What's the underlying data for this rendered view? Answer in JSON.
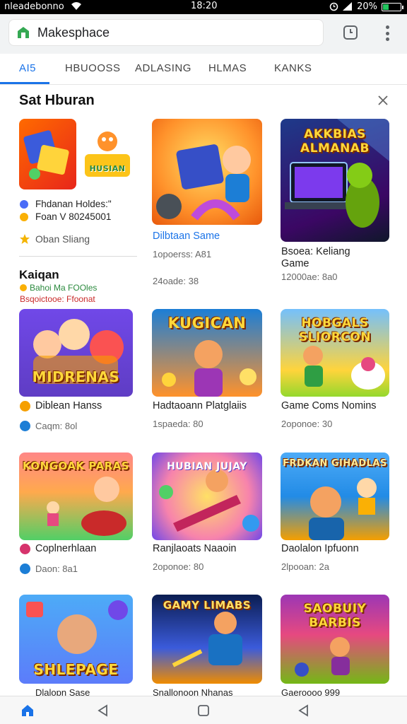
{
  "status_bar": {
    "carrier": "nleadebonno",
    "time": "18:20",
    "battery": "20%"
  },
  "browser": {
    "url": "Makesphace"
  },
  "tabs": [
    {
      "label": "AI5",
      "active": true
    },
    {
      "label": "HBUOOSS",
      "active": false
    },
    {
      "label": "ADLASING",
      "active": false
    },
    {
      "label": "HLMAS",
      "active": false
    },
    {
      "label": "KANKS",
      "active": false
    }
  ],
  "section": {
    "title": "Sat Hburan"
  },
  "promo": {
    "art_text": "HUSIAN",
    "line1": "Fhdanan Holdes:\"",
    "line2": "Foan V 80245001",
    "line3": "Oban Sliang"
  },
  "subsection": {
    "title": "Kaiqan",
    "line1": "Bahoi Ma FOOles",
    "line2": "Bsqoictooe: Ffoonat"
  },
  "games": [
    {
      "name": "Dilbtaan Same",
      "meta": "1opoerss: A81",
      "meta2": "24oade: 38",
      "art": ""
    },
    {
      "name": "Bsoea: Keliang Game",
      "meta": "12000ae: 8a0",
      "art": "AKKBIAS ALMANAB"
    },
    {
      "name": "Diblean Hanss",
      "meta": "Caqm: 8ol",
      "art": "MIDRENAS"
    },
    {
      "name": "Hadtaoann Platglaiis",
      "meta": "1spaeda: 80",
      "art": "KUGICAN"
    },
    {
      "name": "Game Coms Nomins",
      "meta": "2oponoe: 30",
      "art": "HOBGALS SLIORCON"
    },
    {
      "name": "Coplnerhlaan",
      "meta": "Daon: 8a1",
      "art": "KONGOAK PARAS"
    },
    {
      "name": "Ranjlaoats Naaoin",
      "meta": "2oponoe: 80",
      "art": "HUBIAN JUJAY"
    },
    {
      "name": "Daolalon Ipfuonn",
      "meta": "2lpooan: 2a",
      "art": "FRDKAN GIHADLAS"
    },
    {
      "name": "Dlalopn Sase",
      "meta": "",
      "art": "SHLEPAGE"
    },
    {
      "name": "Snallonoon Nhanas",
      "meta": "",
      "art": "GAMY LIMABS"
    },
    {
      "name": "Gaeroooo 999",
      "meta": "",
      "art": "SAOBUIY BARBIS"
    }
  ],
  "colors": {
    "accent": "#1a73e8",
    "star": "#f4b400"
  }
}
